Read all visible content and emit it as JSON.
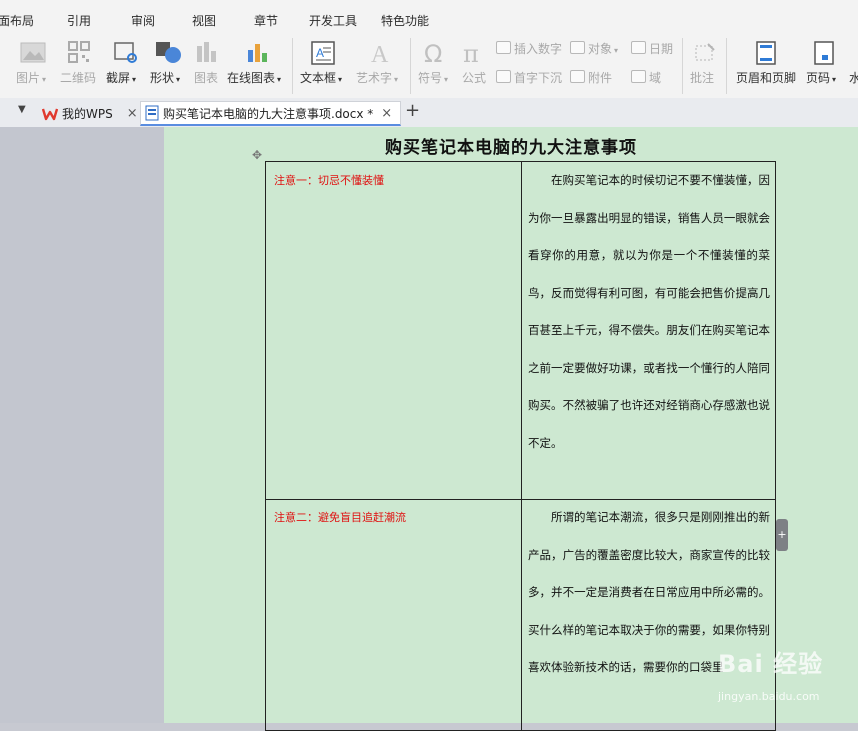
{
  "menu": {
    "items": [
      "面布局",
      "引用",
      "审阅",
      "视图",
      "章节",
      "开发工具",
      "特色功能"
    ]
  },
  "ribbon": {
    "picture": "图片",
    "qrcode": "二维码",
    "screenshot": "截屏",
    "shape": "形状",
    "chart": "图表",
    "online_chart": "在线图表",
    "textbox": "文本框",
    "wordart": "艺术字",
    "symbol": "符号",
    "formula": "公式",
    "insert_number": "插入数字",
    "object": "对象",
    "date": "日期",
    "drop_cap": "首字下沉",
    "attachment": "附件",
    "field": "域",
    "comment": "批注",
    "header_footer": "页眉和页脚",
    "page_number": "页码",
    "watermark_partial": "水"
  },
  "tabs": {
    "my_wps": "我的WPS",
    "document": "购买笔记本电脑的九大注意事项.docx *",
    "close": "×",
    "add": "+"
  },
  "document": {
    "title": "购买笔记本电脑的九大注意事项",
    "sections": [
      {
        "heading": "注意一：切忌不懂装懂",
        "body": "在购买笔记本的时候切记不要不懂装懂，因为你一旦暴露出明显的错误，销售人员一眼就会看穿你的用意，就以为你是一个不懂装懂的菜鸟，反而觉得有利可图，有可能会把售价提高几百甚至上千元，得不偿失。朋友们在购买笔记本之前一定要做好功课，或者找一个懂行的人陪同购买。不然被骗了也许还对经销商心存感激也说不定。"
      },
      {
        "heading": "注意二：避免盲目追赶潮流",
        "body": "所谓的笔记本潮流，很多只是刚刚推出的新产品，广告的覆盖密度比较大，商家宣传的比较多，并不一定是消费者在日常应用中所必需的。买什么样的笔记本取决于你的需要，如果你特别喜欢体验新技术的话，需要你的口袋里"
      }
    ]
  },
  "watermark": {
    "text": "Bai 经验",
    "url": "jingyan.baidu.com"
  },
  "colors": {
    "page_bg": "#cde8d1",
    "heading_red": "#e01010",
    "tab_accent": "#5a8de0"
  }
}
